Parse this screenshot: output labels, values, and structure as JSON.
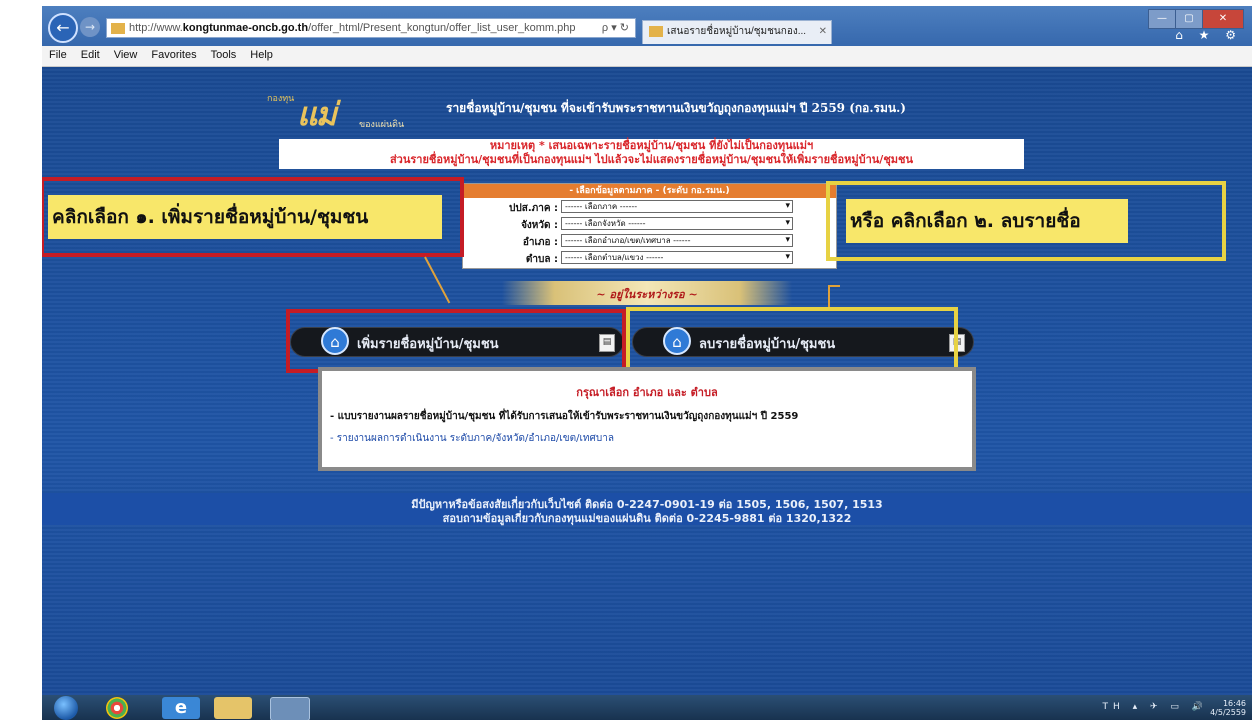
{
  "browser": {
    "url_prefix": "http://www.",
    "url_domain": "kongtunmae-oncb.go.th",
    "url_path": "/offer_html/Present_kongtun/offer_list_user_komm.php",
    "url_controls": "ρ ▾ ↻",
    "tab_title": "เสนอรายชื่อหมู่บ้าน/ชุมชนกอง...",
    "tab_close": "✕",
    "window_controls": [
      "—",
      "▢",
      "✕"
    ],
    "toolbar_icons": "⌂ ★ ⚙",
    "back_glyph": "←",
    "forward_glyph": "→",
    "menu": [
      "File",
      "Edit",
      "View",
      "Favorites",
      "Tools",
      "Help"
    ]
  },
  "logo": {
    "small": "กองทุน",
    "main": "แม่",
    "sub": "ของแผ่นดิน"
  },
  "header_title": "รายชื่อหมู่บ้าน/ชุมชน ที่จะเข้ารับพระราชทานเงินขวัญถุงกองทุนแม่ฯ ปี 2559 (กอ.รมน.)",
  "notice": {
    "line1": "หมายเหตุ * เสนอเฉพาะรายชื่อหมู่บ้าน/ชุมชน ที่ยังไม่เป็นกองทุนแม่ฯ",
    "line2": "ส่วนรายชื่อหมู่บ้าน/ชุมชนที่เป็นกองทุนแม่ฯ ไปแล้วจะไม่แสดงรายชื่อหมู่บ้าน/ชุมชนให้เพิ่มรายชื่อหมู่บ้าน/ชุมชน"
  },
  "form": {
    "heading": "- เลือกข้อมูลตามภาค - (ระดับ กอ.รมน.)",
    "fields": [
      {
        "label": "ปปส.ภาค :",
        "value": "------ เลือกภาค ------"
      },
      {
        "label": "จังหวัด :",
        "value": "------ เลือกจังหวัด ------"
      },
      {
        "label": "อำเภอ :",
        "value": "------ เลือกอำเภอ/เขต/เทศบาล ------"
      },
      {
        "label": "ตำบล :",
        "value": "------ เลือกตำบล/แขวง ------"
      }
    ],
    "arrow": "▾"
  },
  "annotations": {
    "left": "คลิกเลือก ๑. เพิ่มรายชื่อหมู่บ้าน/ชุมชน",
    "right": "หรือ คลิกเลือก ๒. ลบรายชื่อ"
  },
  "divider_text": "~ อยู่ในระหว่างรอ ~",
  "buttons": {
    "add_label": "เพิ่มรายชื่อหมู่บ้าน/ชุมชน",
    "delete_label": "ลบรายชื่อหมู่บ้าน/ชุมชน",
    "home_glyph": "⌂",
    "doc_glyph": "▤"
  },
  "info": {
    "title": "กรุณาเลือก อำเภอ และ ตำบล",
    "line1": "- แบบรายงานผลรายชื่อหมู่บ้าน/ชุมชน ที่ได้รับการเสนอให้เข้ารับพระราชทานเงินขวัญถุงกองทุนแม่ฯ ปี 2559",
    "line2": "- รายงานผลการดำเนินงาน ระดับภาค/จังหวัด/อำเภอ/เขต/เทศบาล"
  },
  "footer": {
    "line1": "มีปัญหาหรือข้อสงสัยเกี่ยวกับเว็บไซต์ ติดต่อ 0-2247-0901-19 ต่อ 1505, 1506, 1507, 1513",
    "line2": "สอบถามข้อมูลเกี่ยวกับกองทุนแม่ของแผ่นดิน ติดต่อ 0-2245-9881 ต่อ 1320,1322"
  },
  "taskbar": {
    "ie_glyph": "e",
    "tray_icons": "TH ▴ ✈ ▭ 🔊",
    "time": "16:46",
    "date": "4/5/2559"
  },
  "colors": {
    "page_bg": "#1d4f9a",
    "notice_red": "#d9262b",
    "annotation_red": "#c51c25",
    "annotation_yellow": "#e7d243",
    "highlight": "#f8e76a",
    "form_header": "#e57d30"
  }
}
